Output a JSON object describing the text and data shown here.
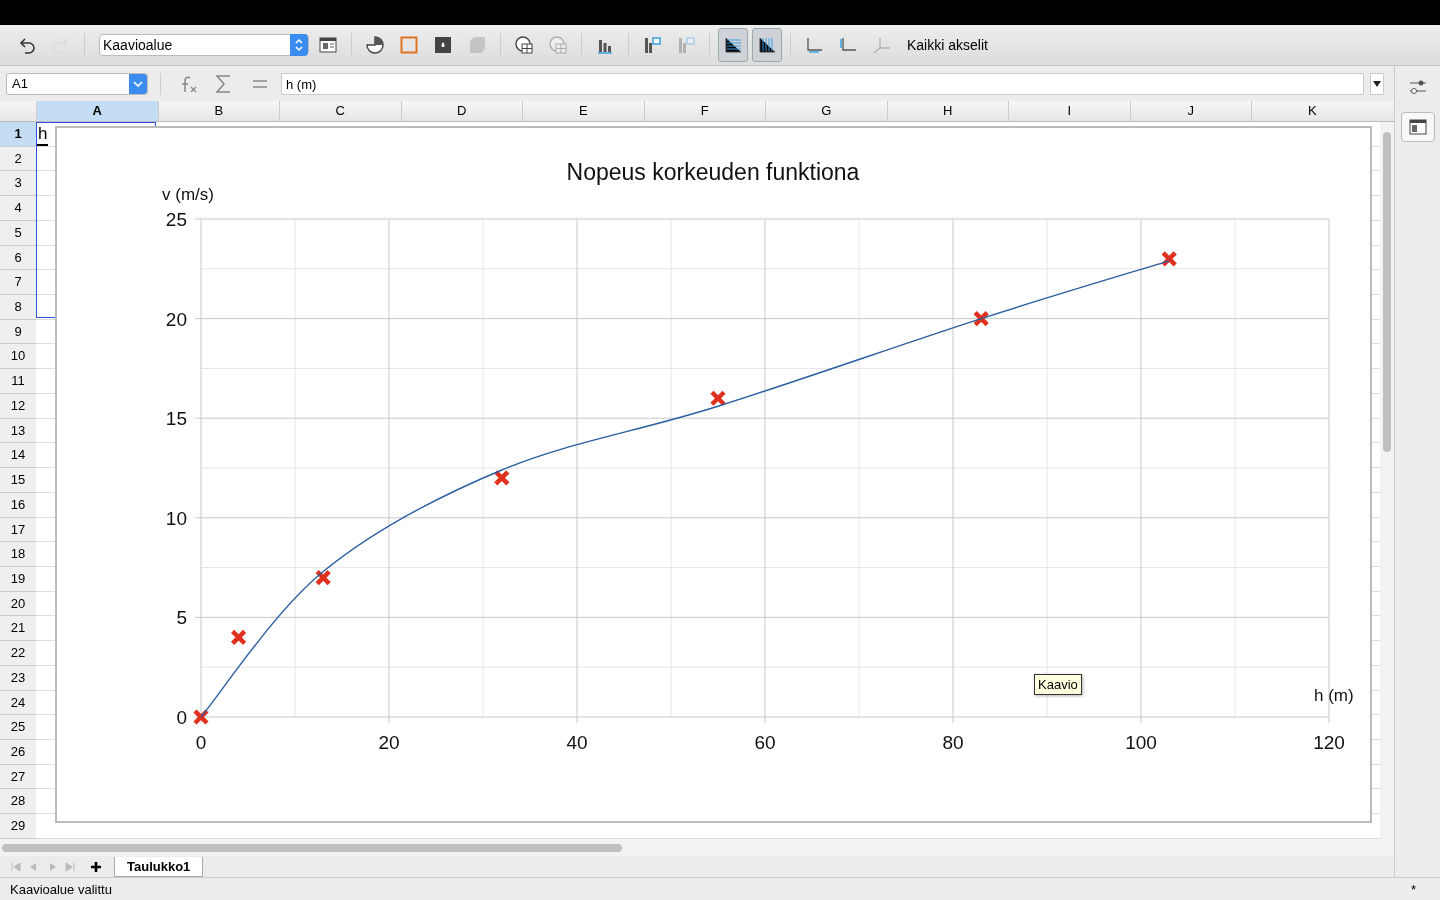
{
  "toolbar": {
    "groups": [
      {
        "items": [
          {
            "kind": "undo",
            "disabled": false,
            "selected": false
          },
          {
            "kind": "redo",
            "disabled": true,
            "selected": false
          }
        ]
      },
      {
        "select": {
          "value": "Kaavioalue"
        },
        "items": [
          {
            "kind": "format",
            "disabled": false,
            "selected": false
          }
        ]
      },
      {
        "items": [
          {
            "kind": "chart-type",
            "disabled": false,
            "selected": false
          },
          {
            "kind": "area",
            "disabled": false,
            "selected": false
          },
          {
            "kind": "wall",
            "disabled": false,
            "selected": false
          },
          {
            "kind": "cube",
            "disabled": true,
            "selected": false
          }
        ]
      },
      {
        "items": [
          {
            "kind": "table",
            "disabled": false,
            "selected": false
          },
          {
            "kind": "range",
            "disabled": true,
            "selected": false
          }
        ]
      },
      {
        "items": [
          {
            "kind": "columns",
            "disabled": false,
            "selected": false
          }
        ]
      },
      {
        "items": [
          {
            "kind": "legend",
            "disabled": false,
            "selected": false
          },
          {
            "kind": "legend",
            "disabled": true,
            "selected": false
          }
        ]
      },
      {
        "items": [
          {
            "kind": "hgrid",
            "disabled": false,
            "selected": true
          },
          {
            "kind": "vgrid",
            "disabled": false,
            "selected": true
          }
        ]
      },
      {
        "items": [
          {
            "kind": "xaxis",
            "disabled": false,
            "selected": false
          },
          {
            "kind": "yaxis",
            "disabled": false,
            "selected": false
          },
          {
            "kind": "zaxis",
            "disabled": true,
            "selected": false
          }
        ],
        "label": "Kaikki akselit"
      }
    ]
  },
  "formula_bar": {
    "name_box": "A1",
    "value": "h (m)"
  },
  "columns": [
    {
      "label": "A",
      "selected": true
    },
    {
      "label": "B",
      "selected": false
    },
    {
      "label": "C",
      "selected": false
    },
    {
      "label": "D",
      "selected": false
    },
    {
      "label": "E",
      "selected": false
    },
    {
      "label": "F",
      "selected": false
    },
    {
      "label": "G",
      "selected": false
    },
    {
      "label": "H",
      "selected": false
    },
    {
      "label": "I",
      "selected": false
    },
    {
      "label": "J",
      "selected": false
    },
    {
      "label": "K",
      "selected": false
    }
  ],
  "rows": [
    {
      "label": "1",
      "selected": true
    },
    {
      "label": "2",
      "selected": false
    },
    {
      "label": "3",
      "selected": false
    },
    {
      "label": "4",
      "selected": false
    },
    {
      "label": "5",
      "selected": false
    },
    {
      "label": "6",
      "selected": false
    },
    {
      "label": "7",
      "selected": false
    },
    {
      "label": "8",
      "selected": false
    },
    {
      "label": "9",
      "selected": false
    },
    {
      "label": "10",
      "selected": false
    },
    {
      "label": "11",
      "selected": false
    },
    {
      "label": "12",
      "selected": false
    },
    {
      "label": "13",
      "selected": false
    },
    {
      "label": "14",
      "selected": false
    },
    {
      "label": "15",
      "selected": false
    },
    {
      "label": "16",
      "selected": false
    },
    {
      "label": "17",
      "selected": false
    },
    {
      "label": "18",
      "selected": false
    },
    {
      "label": "19",
      "selected": false
    },
    {
      "label": "20",
      "selected": false
    },
    {
      "label": "21",
      "selected": false
    },
    {
      "label": "22",
      "selected": false
    },
    {
      "label": "23",
      "selected": false
    },
    {
      "label": "24",
      "selected": false
    },
    {
      "label": "25",
      "selected": false
    },
    {
      "label": "26",
      "selected": false
    },
    {
      "label": "27",
      "selected": false
    },
    {
      "label": "28",
      "selected": false
    },
    {
      "label": "29",
      "selected": false
    }
  ],
  "cell_a1": "h",
  "chart": {
    "tooltip": "Kaavio",
    "chart_data": {
      "type": "scatter",
      "grid": true,
      "title": "Nopeus korkeuden funktiona",
      "xlabel": "h (m)",
      "ylabel": "v (m/s)",
      "xlim": [
        0,
        120
      ],
      "ylim": [
        0,
        25
      ],
      "xticks": [
        0,
        20,
        40,
        60,
        80,
        100,
        120
      ],
      "yticks": [
        0,
        5,
        10,
        15,
        20,
        25
      ],
      "series": [
        {
          "type": "scatter",
          "color": "#e0301e",
          "x": [
            0,
            4,
            13,
            32,
            55,
            83,
            103
          ],
          "values": [
            0,
            4,
            7,
            12,
            16,
            20,
            23
          ]
        },
        {
          "type": "line",
          "color": "#2a5ea0",
          "x": [
            0,
            13,
            32,
            55,
            83,
            103
          ],
          "values": [
            0,
            7.3,
            12.4,
            15.6,
            20,
            22.9
          ]
        }
      ]
    }
  },
  "sheet_tabs": [
    {
      "label": "Taulukko1",
      "selected": true
    }
  ],
  "status_bar": {
    "text": "Kaavioalue valittu",
    "modified": "*"
  }
}
